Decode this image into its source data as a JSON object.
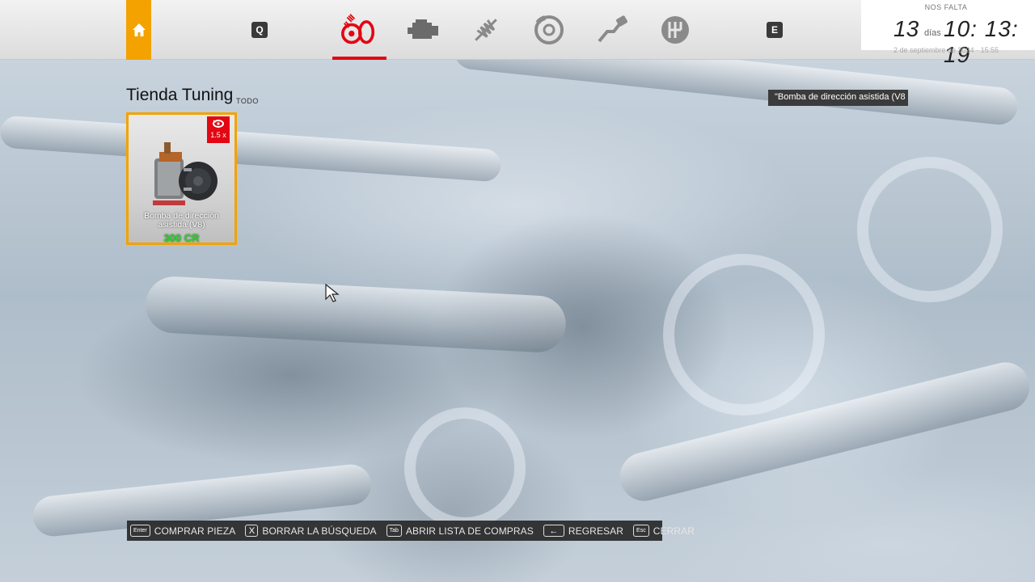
{
  "topbar": {
    "home_icon": "home-icon",
    "prev_key": "Q",
    "next_key": "E",
    "categories": [
      {
        "name": "wheels-tuning-icon",
        "active": true
      },
      {
        "name": "engine-icon",
        "active": false
      },
      {
        "name": "suspension-icon",
        "active": false
      },
      {
        "name": "brakes-icon",
        "active": false
      },
      {
        "name": "exhaust-icon",
        "active": false
      },
      {
        "name": "gearbox-icon",
        "active": false
      }
    ],
    "accent_color": "#e30613",
    "home_color": "#f3a200"
  },
  "countdown": {
    "label": "NOS FALTA",
    "days": "13",
    "days_word": "días",
    "time": "10: 13: 19",
    "date": "2 de septiembre de 2024 · 15:55"
  },
  "shop": {
    "title": "Tienda Tuning",
    "filter": "TODO",
    "items": [
      {
        "name": "Bomba de dirección asistida (V8)",
        "price": "300 CR",
        "badge_pct": "1.5 x",
        "badge_icon": "turbo-icon"
      }
    ]
  },
  "tooltip": {
    "text": "\"Bomba de dirección asistida (V8"
  },
  "hints": [
    {
      "key": "Enter",
      "label": "COMPRAR PIEZA",
      "big": false
    },
    {
      "key": "X",
      "label": "BORRAR LA BÚSQUEDA",
      "big": true
    },
    {
      "key": "Tab",
      "label": "ABRIR LISTA DE COMPRAS",
      "big": false
    },
    {
      "key": "←",
      "label": "REGRESAR",
      "big": true
    },
    {
      "key": "Esc",
      "label": "CERRAR",
      "big": false
    }
  ]
}
